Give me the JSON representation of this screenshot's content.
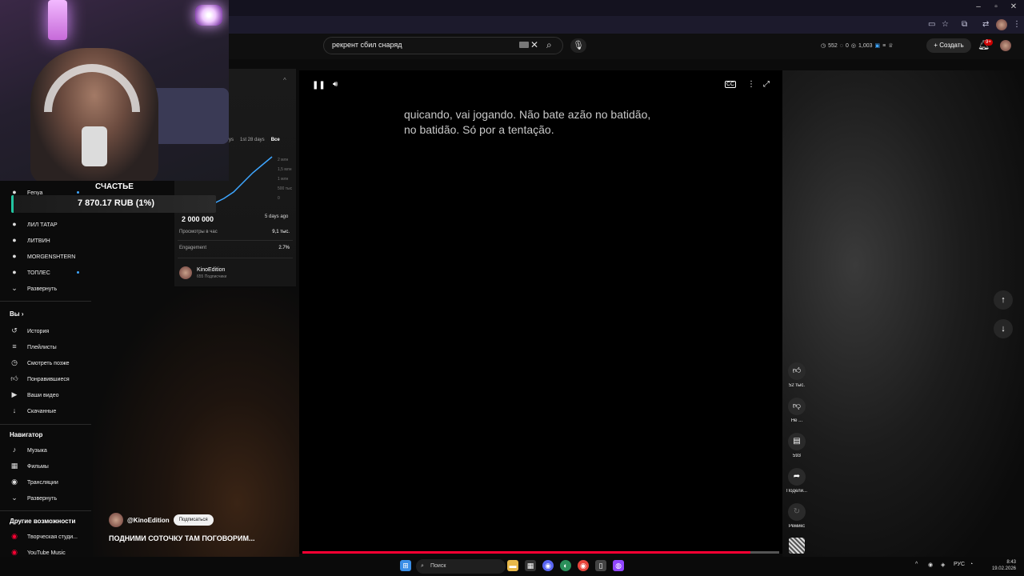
{
  "search": {
    "query": "рекрент сбил снаряд"
  },
  "header": {
    "stats": [
      "552",
      "0",
      "1,003"
    ],
    "create_label": "Создать",
    "notif_count": "9+"
  },
  "overlay": {
    "title": "СЧАСТЬЕ",
    "amount": "7 870.17 RUB (1%)"
  },
  "sidebar": {
    "subscriptions": [
      {
        "label": "Fenya"
      },
      {
        "label": "ЛИЛ ТАТАР"
      },
      {
        "label": "ЛИТВИН"
      },
      {
        "label": "MORGENSHTERN"
      },
      {
        "label": "ТОПЛЕС"
      },
      {
        "label": "Развернуть"
      }
    ],
    "you_header": "Вы",
    "you_items": [
      {
        "label": "История"
      },
      {
        "label": "Плейлисты"
      },
      {
        "label": "Смотреть позже"
      },
      {
        "label": "Понравившиеся"
      },
      {
        "label": "Ваши видео"
      },
      {
        "label": "Скачанные"
      }
    ],
    "nav_header": "Навигатор",
    "nav_items": [
      {
        "label": "Музыка"
      },
      {
        "label": "Фильмы"
      },
      {
        "label": "Трансляции"
      },
      {
        "label": "Развернуть"
      }
    ],
    "other_header": "Другие возможности",
    "other_items": [
      {
        "label": "Творческая студи..."
      },
      {
        "label": "YouTube Music"
      }
    ]
  },
  "analytics": {
    "chips": [
      "ys",
      "1st 28 days",
      "Все"
    ],
    "y_labels": [
      "2 млн",
      "1,5 млн",
      "1 млн",
      "500 тыс",
      "0"
    ],
    "total_views": "2 000 000",
    "ago": "5 days ago",
    "rows": [
      {
        "label": "Просмотры в час",
        "value": "9,1 тыс."
      },
      {
        "label": "Engagement",
        "value": "2.7%"
      }
    ],
    "channel_name": "KinoEdition",
    "channel_subs": "655 Подписчики"
  },
  "short": {
    "author": "@KinoEdition",
    "subscribe_label": "Подписаться",
    "title": "ПОДНИМИ СОТОЧКУ ТАМ ПОГОВОРИМ...",
    "caption": "quicando, vai jogando. Não bate azão no batidão, no batidão. Só por a tentação.",
    "progress": 0.94
  },
  "actions": {
    "likes": "52 тыс.",
    "dislike": "Не ...",
    "comments": "593",
    "share": "Подели...",
    "remix": "Ремикс"
  },
  "taskbar": {
    "search_label": "Поиск",
    "lang": "РУС",
    "time": "8:43",
    "date": "19.02.2026"
  }
}
